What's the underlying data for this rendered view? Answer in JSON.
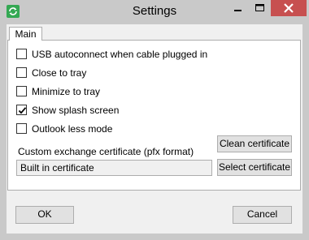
{
  "window": {
    "title": "Settings",
    "icons": {
      "app": "refresh-icon",
      "minimize": "minimize-icon",
      "maximize": "maximize-icon",
      "close": "close-icon"
    },
    "colors": {
      "close_button": "#c75050",
      "titlebar": "#c9c9c9",
      "app_icon": "#34a853"
    }
  },
  "tabs": [
    {
      "label": "Main",
      "selected": true
    }
  ],
  "options": [
    {
      "label": "USB autoconnect when cable plugged in",
      "checked": false
    },
    {
      "label": "Close to tray",
      "checked": false
    },
    {
      "label": "Minimize to tray",
      "checked": false
    },
    {
      "label": "Show splash screen",
      "checked": true
    },
    {
      "label": "Outlook less mode",
      "checked": false
    }
  ],
  "certificate": {
    "label": "Custom exchange certificate (pfx format)",
    "value": "Built in certificate",
    "clean_label": "Clean certificate",
    "select_label": "Select certificate"
  },
  "footer": {
    "ok_label": "OK",
    "cancel_label": "Cancel"
  }
}
